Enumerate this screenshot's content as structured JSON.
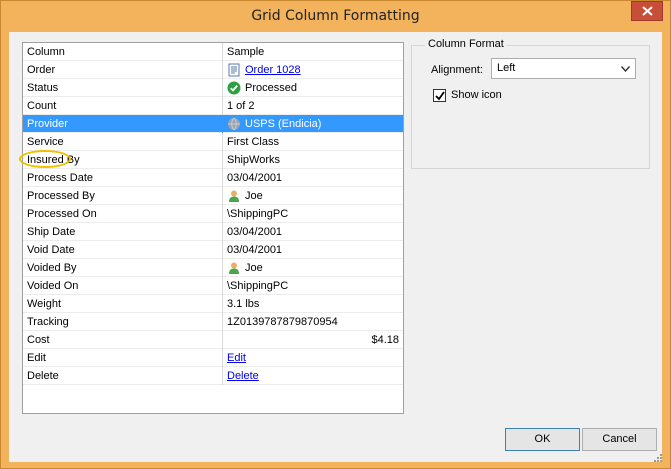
{
  "dialog": {
    "title": "Grid Column Formatting"
  },
  "grid": {
    "header": {
      "column": "Column",
      "sample": "Sample"
    },
    "rows": [
      {
        "column": "Order",
        "sample": "Order 1028",
        "link": true,
        "icon": "document-icon"
      },
      {
        "column": "Status",
        "sample": "Processed",
        "icon": "checkmark-icon"
      },
      {
        "column": "Count",
        "sample": "1 of 2"
      },
      {
        "column": "Provider",
        "sample": "USPS (Endicia)",
        "icon": "globe-icon",
        "selected": true
      },
      {
        "column": "Service",
        "sample": "First Class"
      },
      {
        "column": "Insured By",
        "sample": "ShipWorks"
      },
      {
        "column": "Process Date",
        "sample": "03/04/2001"
      },
      {
        "column": "Processed By",
        "sample": "Joe",
        "icon": "user-icon"
      },
      {
        "column": "Processed On",
        "sample": "\\ShippingPC"
      },
      {
        "column": "Ship Date",
        "sample": "03/04/2001"
      },
      {
        "column": "Void Date",
        "sample": "03/04/2001"
      },
      {
        "column": "Voided By",
        "sample": "Joe",
        "icon": "user-icon"
      },
      {
        "column": "Voided On",
        "sample": "\\ShippingPC"
      },
      {
        "column": "Weight",
        "sample": "3.1 lbs"
      },
      {
        "column": "Tracking",
        "sample": "1Z0139787879870954"
      },
      {
        "column": "Cost",
        "sample": "$4.18",
        "align": "right"
      },
      {
        "column": "Edit",
        "sample": "Edit",
        "link": true
      },
      {
        "column": "Delete",
        "sample": "Delete",
        "link": true
      }
    ]
  },
  "format": {
    "group_title": "Column Format",
    "alignment_label": "Alignment:",
    "alignment_value": "Left",
    "show_icon_label": "Show icon",
    "show_icon_checked": true
  },
  "buttons": {
    "ok": "OK",
    "cancel": "Cancel"
  },
  "colors": {
    "titlebar": "#f2b35c",
    "selection": "#3399ff",
    "link": "#0000ee",
    "highlight_oval": "#f0c000"
  }
}
